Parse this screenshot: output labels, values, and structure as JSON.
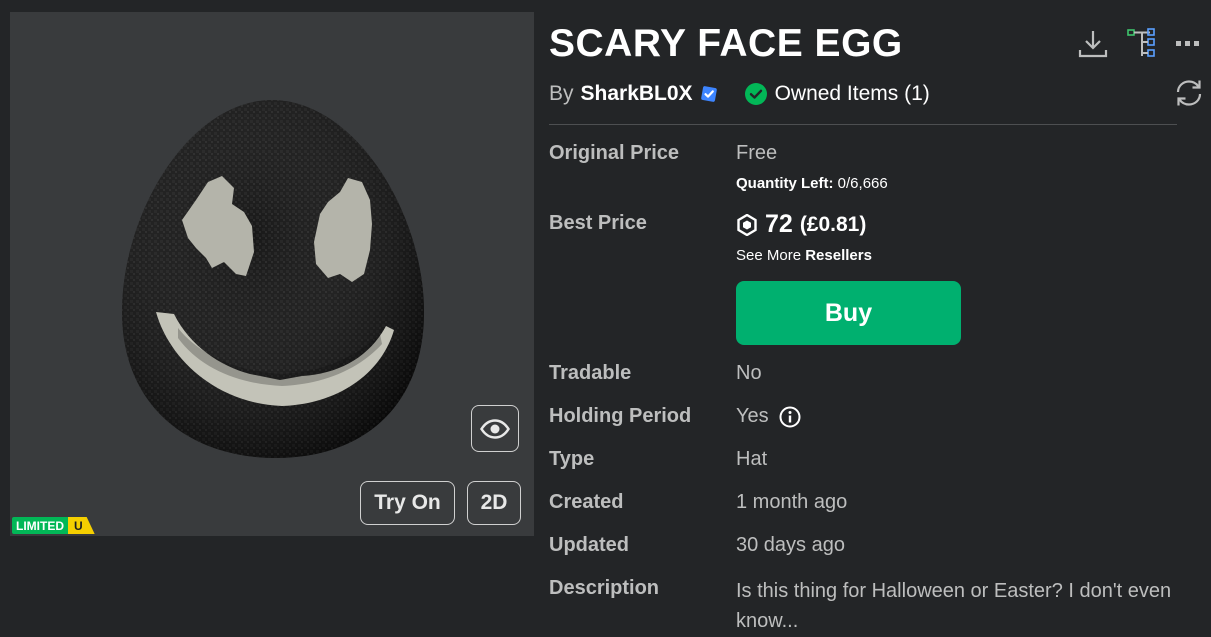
{
  "item": {
    "title": "SCARY FACE EGG",
    "by_prefix": "By",
    "creator": "SharkBL0X",
    "owned_text": "Owned Items (1)"
  },
  "thumbnail": {
    "try_on_label": "Try On",
    "view_2d_label": "2D",
    "badge_limited": "LIMITED",
    "badge_u": "U"
  },
  "details": {
    "original_price_label": "Original Price",
    "original_price_value": "Free",
    "quantity_left_label": "Quantity Left:",
    "quantity_left_value": "0/6,666",
    "best_price_label": "Best Price",
    "best_price_amount": "72",
    "best_price_local": "(£0.81)",
    "see_more_prefix": "See More",
    "see_more_link": "Resellers",
    "buy_label": "Buy",
    "tradable_label": "Tradable",
    "tradable_value": "No",
    "holding_period_label": "Holding Period",
    "holding_period_value": "Yes",
    "type_label": "Type",
    "type_value": "Hat",
    "created_label": "Created",
    "created_value": "1 month ago",
    "updated_label": "Updated",
    "updated_value": "30 days ago",
    "description_label": "Description",
    "description_value": "Is this thing for Halloween or Easter? I don't even know..."
  },
  "icons": {
    "download": "download-icon",
    "tree": "hierarchy-icon",
    "more": "more-options-icon",
    "refresh": "refresh-icon",
    "eye": "eye-icon",
    "verified": "verified-badge-icon",
    "owned": "check-circle-icon",
    "robux": "robux-icon",
    "info": "info-icon"
  },
  "colors": {
    "background": "#232527",
    "thumbnail_bg": "#393b3d",
    "buy_button": "#00b06f",
    "owned_check": "#02b757",
    "verified": "#3d85ff",
    "limited_green": "#02b757",
    "limited_yellow": "#f5cf00"
  }
}
